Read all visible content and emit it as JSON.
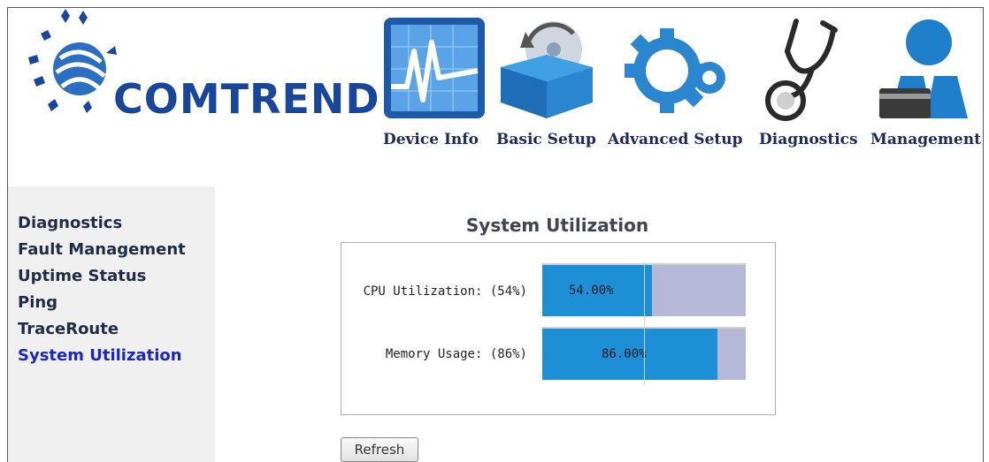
{
  "brand": {
    "name": "COMTREND"
  },
  "nav": [
    {
      "label": "Device Info",
      "icon": "device-info-monitor-icon"
    },
    {
      "label": "Basic Setup",
      "icon": "basic-setup-box-icon"
    },
    {
      "label": "Advanced Setup",
      "icon": "advanced-setup-gears-icon"
    },
    {
      "label": "Diagnostics",
      "icon": "stethoscope-icon"
    },
    {
      "label": "Management",
      "icon": "person-card-icon"
    }
  ],
  "sidebar": {
    "items": [
      {
        "label": "Diagnostics"
      },
      {
        "label": "Fault Management"
      },
      {
        "label": "Uptime Status"
      },
      {
        "label": "Ping"
      },
      {
        "label": "TraceRoute"
      },
      {
        "label": "System Utilization",
        "active": true
      }
    ]
  },
  "main": {
    "title": "System Utilization",
    "cpu": {
      "label": "CPU Utilization: (54%)",
      "value_text": "54.00%",
      "fraction": 0.54
    },
    "memory": {
      "label": "Memory Usage: (86%)",
      "value_text": "86.00%",
      "fraction": 0.86
    },
    "refresh_label": "Refresh"
  },
  "colors": {
    "brand_blue": "#17469a",
    "bar_fill": "#1d8fd6",
    "bar_track": "#b5b9d7",
    "active_link": "#1a25c8"
  }
}
